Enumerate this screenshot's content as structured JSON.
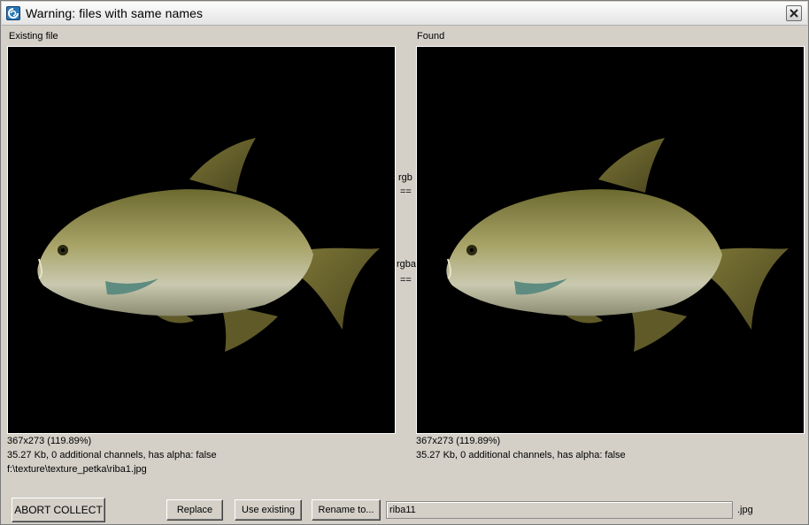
{
  "window": {
    "title": "Warning: files with same names"
  },
  "existing": {
    "label": "Existing file",
    "dimensions": "367x273 (119.89%)",
    "info": "35.27 Kb, 0 additional channels, has alpha: false",
    "path": "f:\\texture\\texture_petka\\riba1.jpg"
  },
  "found": {
    "label": "Found",
    "dimensions": "367x273 (119.89%)",
    "info": "35.27 Kb, 0 additional channels, has alpha: false"
  },
  "compare": {
    "rgb_label": "rgb",
    "rgb_result": "==",
    "rgba_label": "rgba",
    "rgba_result": "=="
  },
  "actions": {
    "abort": "ABORT COLLECT",
    "replace": "Replace",
    "use_existing": "Use existing",
    "rename": "Rename to..."
  },
  "rename_field": {
    "value": "riba11",
    "extension": ".jpg"
  },
  "colors": {
    "panel_bg": "#d4d0c8",
    "image_bg": "#000000"
  }
}
